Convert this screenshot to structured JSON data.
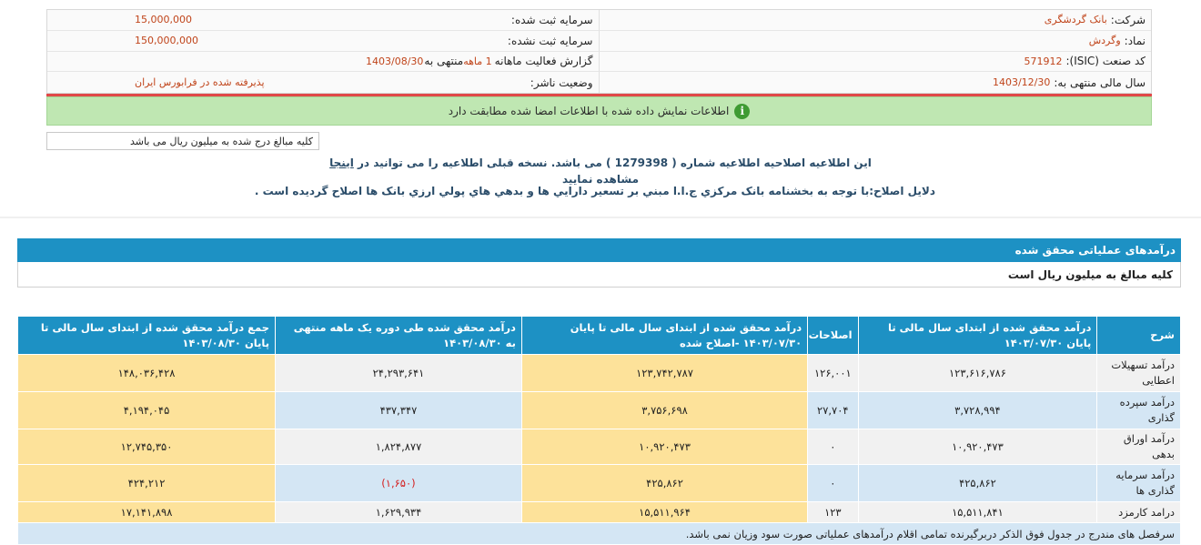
{
  "header": {
    "company_label": "شرکت:",
    "company_value": "بانک گردشگری",
    "registered_capital_label": "سرمایه ثبت شده:",
    "registered_capital_value": "15,000,000",
    "symbol_label": "نماد:",
    "symbol_value": "وگردش",
    "unregistered_capital_label": "سرمایه ثبت نشده:",
    "unregistered_capital_value": "150,000,000",
    "isic_label": "کد صنعت (ISIC):",
    "isic_value": "571912",
    "report_label": "گزارش فعالیت ماهانه",
    "report_value": "1 ماهه",
    "report_suffix": "منتهی به",
    "report_date": "1403/08/30",
    "fiscal_year_label": "سال مالی منتهی به:",
    "fiscal_year_value": "1403/12/30",
    "publisher_status_label": "وضعیت ناشر:",
    "publisher_status_value": "پذیرفته شده در فرابورس ایران"
  },
  "notice": {
    "info_icon": "i",
    "verified_text": "اطلاعات نمایش داده شده با اطلاعات امضا شده مطابقت دارد",
    "amount_note": "کلیه مبالغ درج شده به میلیون ریال می باشد",
    "correction_prefix": "این اطلاعیه اصلاحیه اطلاعیه شماره (",
    "correction_number": "1279398",
    "correction_mid": ") می باشد. نسخه قبلی اطلاعیه را می توانید در",
    "correction_link": "اینجا",
    "correction_suffix": "مشاهده نمایید",
    "reason_text": "دلایل اصلاح:با توجه به بخشنامه بانک مرکزي ج.ا.ا مبني بر تسعير دارايي ها و بدهي هاي پولي ارزي بانک ها اصلاح گرديده است ."
  },
  "section": {
    "title": "درآمدهای عملیاتی محقق شده",
    "subtitle": "کلیه مبالغ به میلیون ریال است"
  },
  "table": {
    "headers": [
      "شرح",
      "درآمد محقق شده از ابتدای سال مالی تا پایان ۱۴۰۳/۰۷/۳۰",
      "اصلاحات",
      "درآمد محقق شده از ابتدای سال مالی تا پایان ۱۴۰۳/۰۷/۳۰ -اصلاح شده",
      "درآمد محقق شده طی دوره یک ماهه منتهی به ۱۴۰۳/۰۸/۳۰",
      "جمع درآمد محقق شده از ابتدای سال مالی تا پایان ۱۴۰۳/۰۸/۳۰"
    ],
    "rows": [
      [
        "درآمد تسهیلات اعطایی",
        "۱۲۳,۶۱۶,۷۸۶",
        "۱۲۶,۰۰۱",
        "۱۲۳,۷۴۲,۷۸۷",
        "۲۴,۲۹۳,۶۴۱",
        "۱۴۸,۰۳۶,۴۲۸"
      ],
      [
        "درآمد سپرده گذاری",
        "۳,۷۲۸,۹۹۴",
        "۲۷,۷۰۴",
        "۳,۷۵۶,۶۹۸",
        "۴۳۷,۳۴۷",
        "۴,۱۹۴,۰۴۵"
      ],
      [
        "درآمد اوراق بدهی",
        "۱۰,۹۲۰,۴۷۳",
        "۰",
        "۱۰,۹۲۰,۴۷۳",
        "۱,۸۲۴,۸۷۷",
        "۱۲,۷۴۵,۳۵۰"
      ],
      [
        "درآمد سرمایه گذاری ها",
        "۴۲۵,۸۶۲",
        "۰",
        "۴۲۵,۸۶۲",
        "(۱,۶۵۰)",
        "۴۲۴,۲۱۲"
      ],
      [
        "درامد کارمزد",
        "۱۵,۵۱۱,۸۴۱",
        "۱۲۳",
        "۱۵,۵۱۱,۹۶۴",
        "۱,۶۲۹,۹۳۴",
        "۱۷,۱۴۱,۸۹۸"
      ]
    ],
    "footer": "سرفصل های مندرج در جدول فوق الذکر دربرگیرنده تمامی اقلام درآمدهای عملیاتی صورت سود وزیان نمی باشد."
  },
  "colors": {
    "header_blue": "#1d91c4",
    "highlight_yellow": "#fde29a",
    "row_blue": "#d4e6f4",
    "negative_red": "#d41e1e",
    "success_green": "#bfe7b2"
  }
}
